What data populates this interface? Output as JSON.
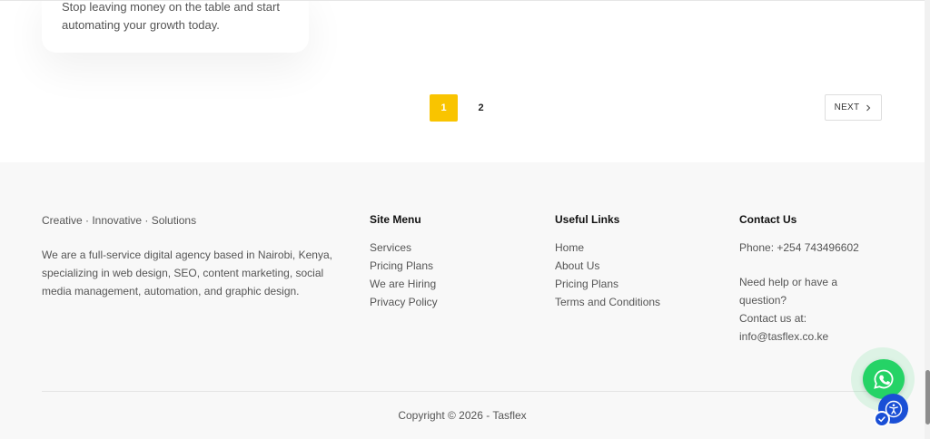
{
  "card": {
    "text": "Stop leaving money on the table and start automating your growth today."
  },
  "pagination": {
    "pages": [
      "1",
      "2"
    ],
    "current": "1",
    "next_label": "NEXT"
  },
  "footer": {
    "tagline": "Creative · Innovative · Solutions",
    "about": "We are a full-service digital agency based in Nairobi, Kenya, specializing in web design, SEO, content marketing, social media management, automation, and graphic design.",
    "site_menu": {
      "title": "Site Menu",
      "items": [
        "Services",
        "Pricing Plans",
        "We are Hiring",
        "Privacy Policy"
      ]
    },
    "useful_links": {
      "title": "Useful Links",
      "items": [
        "Home",
        "About Us",
        "Pricing Plans",
        "Terms and Conditions"
      ]
    },
    "contact": {
      "title": "Contact Us",
      "phone": "Phone: +254 743496602",
      "help_line1": "Need help or have a",
      "help_line2": "question?",
      "contact_at": "Contact us at:",
      "email": "info@tasflex.co.ke"
    },
    "copyright": "Copyright © 2026 -  Tasflex"
  },
  "widgets": {
    "whatsapp_icon": "whatsapp-icon",
    "accessibility_icon": "accessibility-icon",
    "whatsapp_color": "#25d366",
    "accessibility_color": "#1a4fd6"
  }
}
